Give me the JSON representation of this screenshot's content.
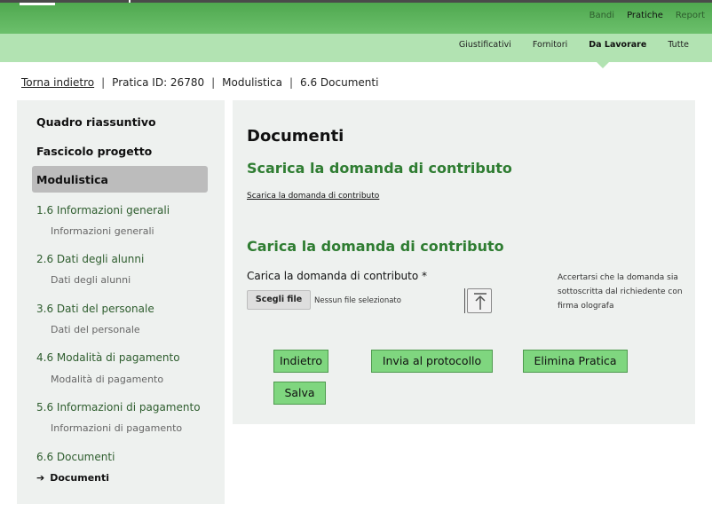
{
  "top_nav": {
    "items": [
      {
        "label": "Bandi"
      },
      {
        "label": "Pratiche"
      },
      {
        "label": "Report"
      }
    ]
  },
  "sub_nav": {
    "items": [
      {
        "label": "Giustificativi"
      },
      {
        "label": "Fornitori"
      },
      {
        "label": "Da Lavorare"
      },
      {
        "label": "Tutte"
      }
    ]
  },
  "breadcrumb": {
    "back": "Torna indietro",
    "pratica": "Pratica ID: 26780",
    "modulistica": "Modulistica",
    "current": "6.6 Documenti"
  },
  "sidebar": {
    "quadro": "Quadro riassuntivo",
    "fascicolo": "Fascicolo progetto",
    "modulistica": "Modulistica",
    "sections": [
      {
        "title": "1.6 Informazioni generali",
        "sub": "Informazioni generali"
      },
      {
        "title": "2.6 Dati degli alunni",
        "sub": "Dati degli alunni"
      },
      {
        "title": "3.6 Dati del personale",
        "sub": "Dati del personale"
      },
      {
        "title": "4.6 Modalità di pagamento",
        "sub": "Modalità di pagamento"
      },
      {
        "title": "5.6 Informazioni di pagamento",
        "sub": "Informazioni di pagamento"
      },
      {
        "title": "6.6 Documenti",
        "sub": "Documenti"
      }
    ],
    "current_arrow": "➔"
  },
  "main": {
    "title": "Documenti",
    "download_heading": "Scarica la domanda di contributo",
    "download_link": "Scarica la domanda di contributo",
    "upload_heading": "Carica la domanda di contributo",
    "upload_label": "Carica la domanda di contributo *",
    "file_button": "Scegli file",
    "file_status": "Nessun file selezionato",
    "note": "Accertarsi che la domanda sia sottoscritta dal richiedente con firma olografa",
    "buttons": {
      "back": "Indietro",
      "send": "Invia al protocollo",
      "delete": "Elimina Pratica",
      "save": "Salva"
    }
  },
  "icons": {
    "upload": "upload-icon",
    "arrow": "arrow-right-icon"
  },
  "colors": {
    "primary_green": "#4fa84f",
    "sub_green": "#b2e3b2",
    "heading_green": "#2f7d32",
    "button_green": "#7fd67f"
  }
}
